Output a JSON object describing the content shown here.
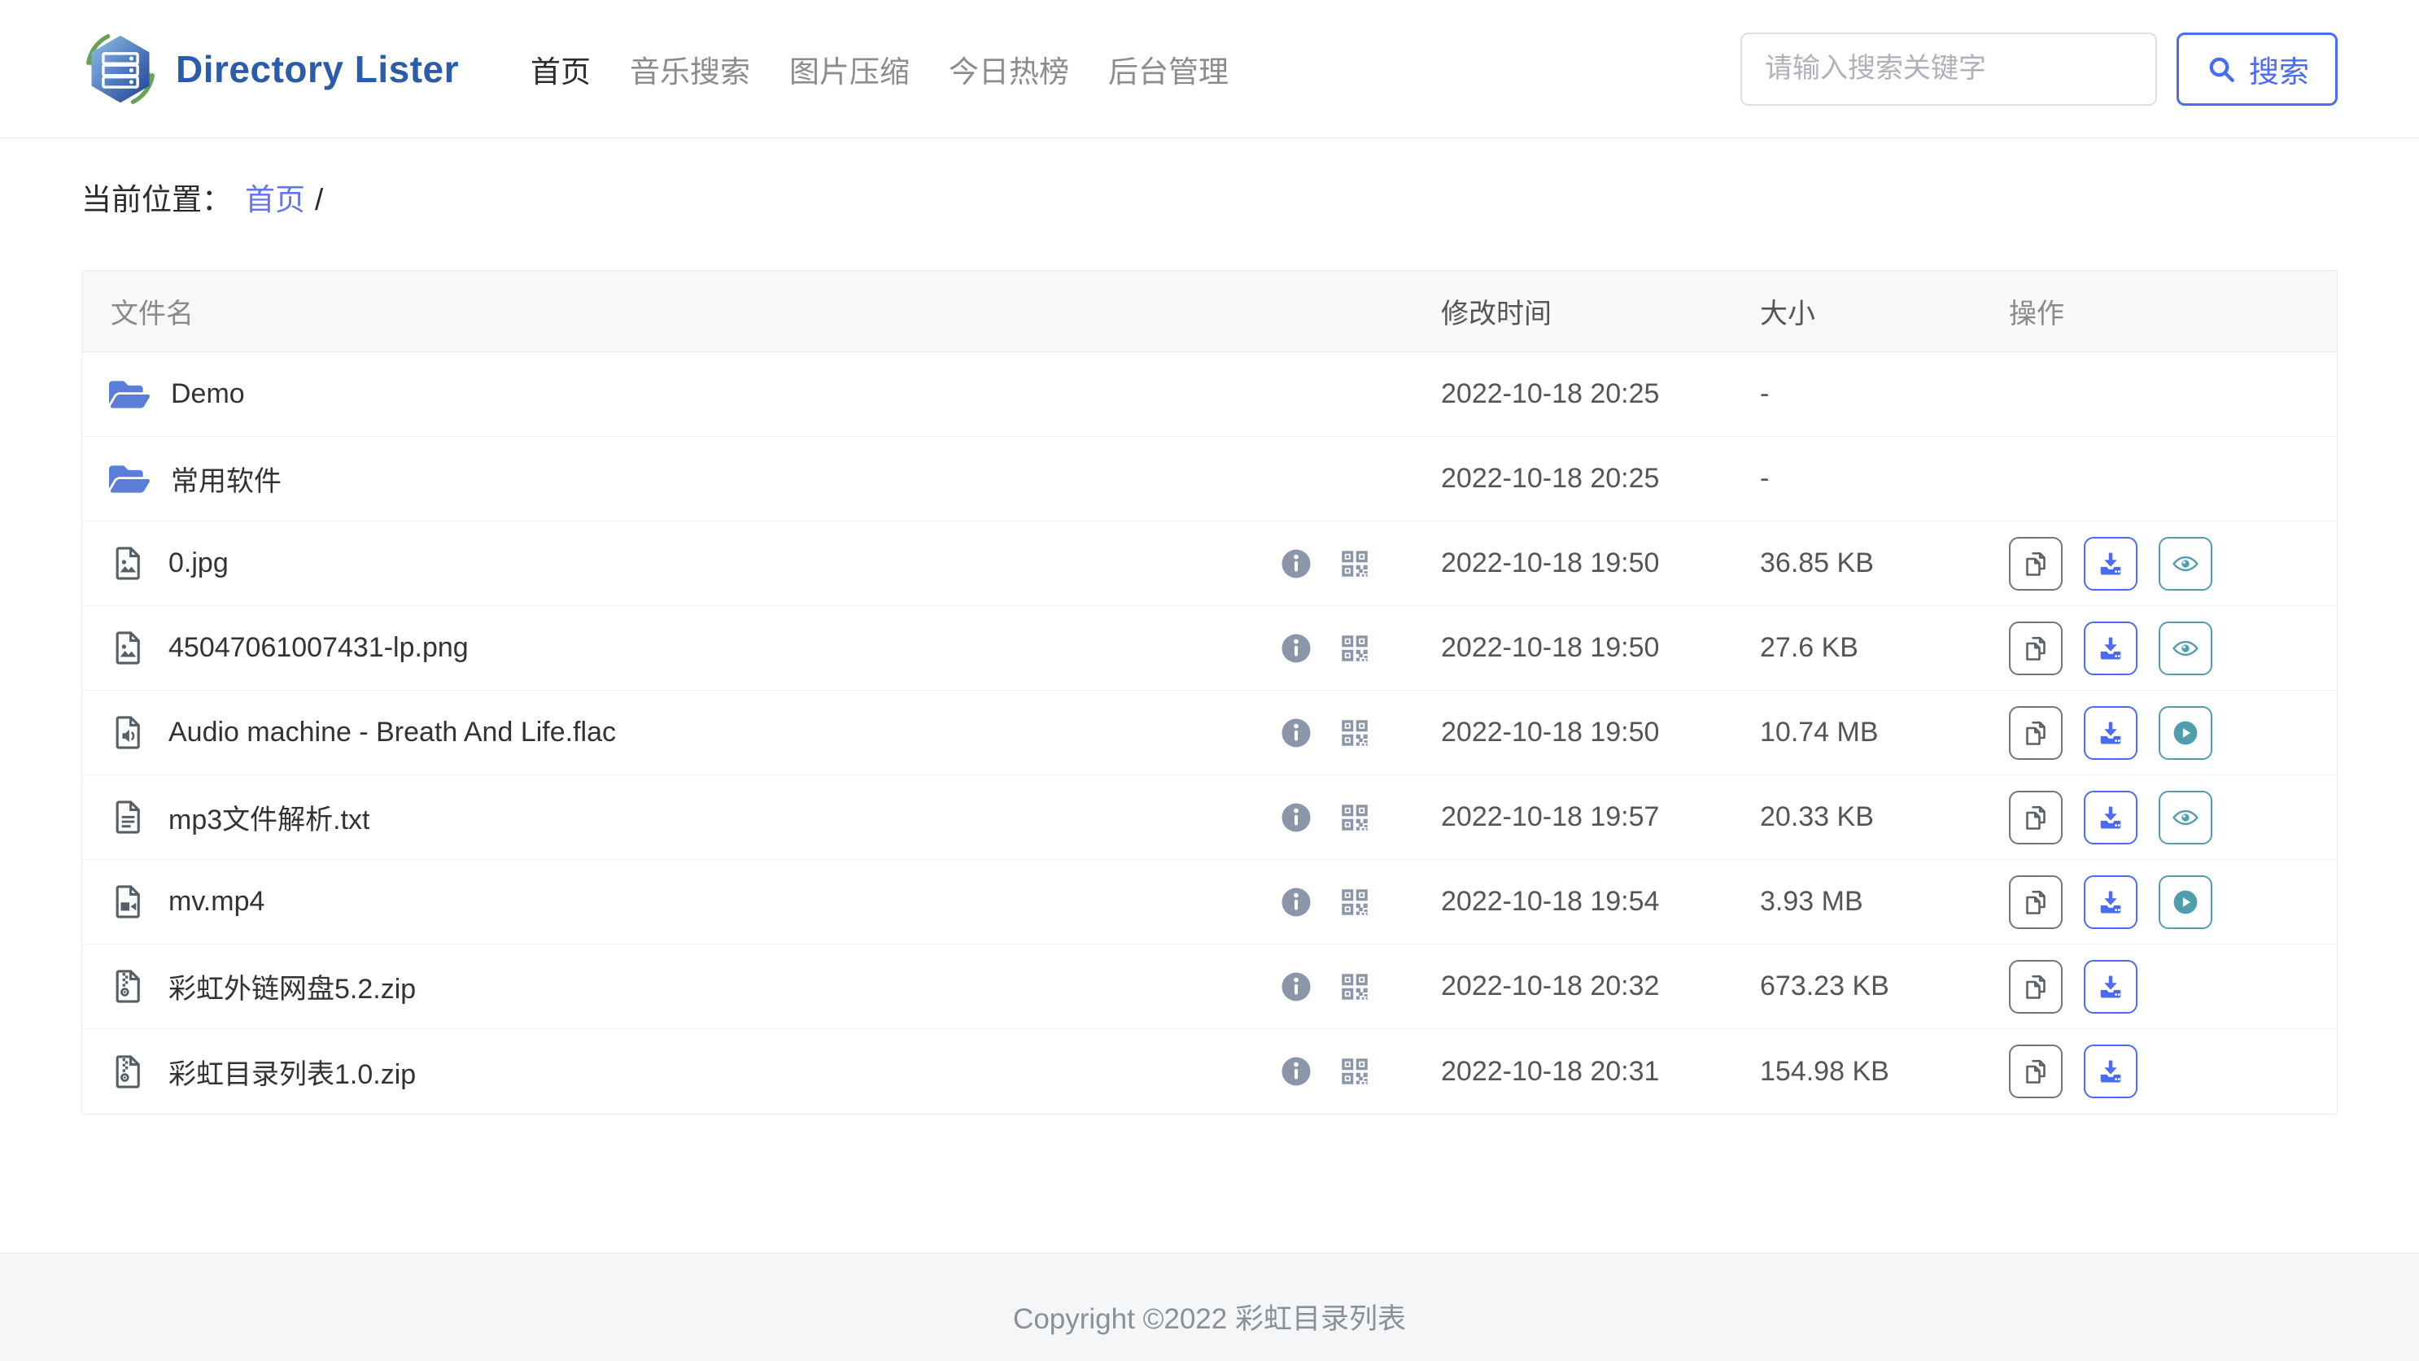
{
  "brand": {
    "name": "Directory Lister"
  },
  "nav": {
    "items": [
      {
        "label": "首页",
        "active": true
      },
      {
        "label": "音乐搜索",
        "active": false
      },
      {
        "label": "图片压缩",
        "active": false
      },
      {
        "label": "今日热榜",
        "active": false
      },
      {
        "label": "后台管理",
        "active": false
      }
    ]
  },
  "search": {
    "placeholder": "请输入搜索关键字",
    "button_label": "搜索"
  },
  "breadcrumb": {
    "prefix": "当前位置：",
    "home": "首页",
    "separator": "/"
  },
  "table": {
    "headers": {
      "name": "文件名",
      "modified": "修改时间",
      "size": "大小",
      "actions": "操作"
    },
    "rows": [
      {
        "name": "Demo",
        "type": "folder",
        "modified": "2022-10-18 20:25",
        "size": "-",
        "badges": [],
        "actions": []
      },
      {
        "name": "常用软件",
        "type": "folder",
        "modified": "2022-10-18 20:25",
        "size": "-",
        "badges": [],
        "actions": []
      },
      {
        "name": "0.jpg",
        "type": "image",
        "modified": "2022-10-18 19:50",
        "size": "36.85 KB",
        "badges": [
          "info",
          "qrcode"
        ],
        "actions": [
          "copy",
          "download",
          "view"
        ]
      },
      {
        "name": "45047061007431-lp.png",
        "type": "image",
        "modified": "2022-10-18 19:50",
        "size": "27.6 KB",
        "badges": [
          "info",
          "qrcode"
        ],
        "actions": [
          "copy",
          "download",
          "view"
        ]
      },
      {
        "name": "Audio machine - Breath And Life.flac",
        "type": "audio",
        "modified": "2022-10-18 19:50",
        "size": "10.74 MB",
        "badges": [
          "info",
          "qrcode"
        ],
        "actions": [
          "copy",
          "download",
          "play"
        ]
      },
      {
        "name": "mp3文件解析.txt",
        "type": "text",
        "modified": "2022-10-18 19:57",
        "size": "20.33 KB",
        "badges": [
          "info",
          "qrcode"
        ],
        "actions": [
          "copy",
          "download",
          "view"
        ]
      },
      {
        "name": "mv.mp4",
        "type": "video",
        "modified": "2022-10-18 19:54",
        "size": "3.93 MB",
        "badges": [
          "info",
          "qrcode"
        ],
        "actions": [
          "copy",
          "download",
          "play"
        ]
      },
      {
        "name": "彩虹外链网盘5.2.zip",
        "type": "zip",
        "modified": "2022-10-18 20:32",
        "size": "673.23 KB",
        "badges": [
          "info",
          "qrcode"
        ],
        "actions": [
          "copy",
          "download"
        ]
      },
      {
        "name": "彩虹目录列表1.0.zip",
        "type": "zip",
        "modified": "2022-10-18 20:31",
        "size": "154.98 KB",
        "badges": [
          "info",
          "qrcode"
        ],
        "actions": [
          "copy",
          "download"
        ]
      }
    ]
  },
  "footer": {
    "copyright": "Copyright ©2022 彩虹目录列表"
  },
  "colors": {
    "primary": "#4a6cf5",
    "link": "#6577e8",
    "teal": "#4f9dad",
    "brand": "#2a5caa",
    "folderIcon": "#5b7fd8",
    "fileIcon": "#565e66",
    "mutedIcon": "#8b97a9",
    "headerBg": "#f8f8f8",
    "footerBg": "#f5f6f7"
  }
}
